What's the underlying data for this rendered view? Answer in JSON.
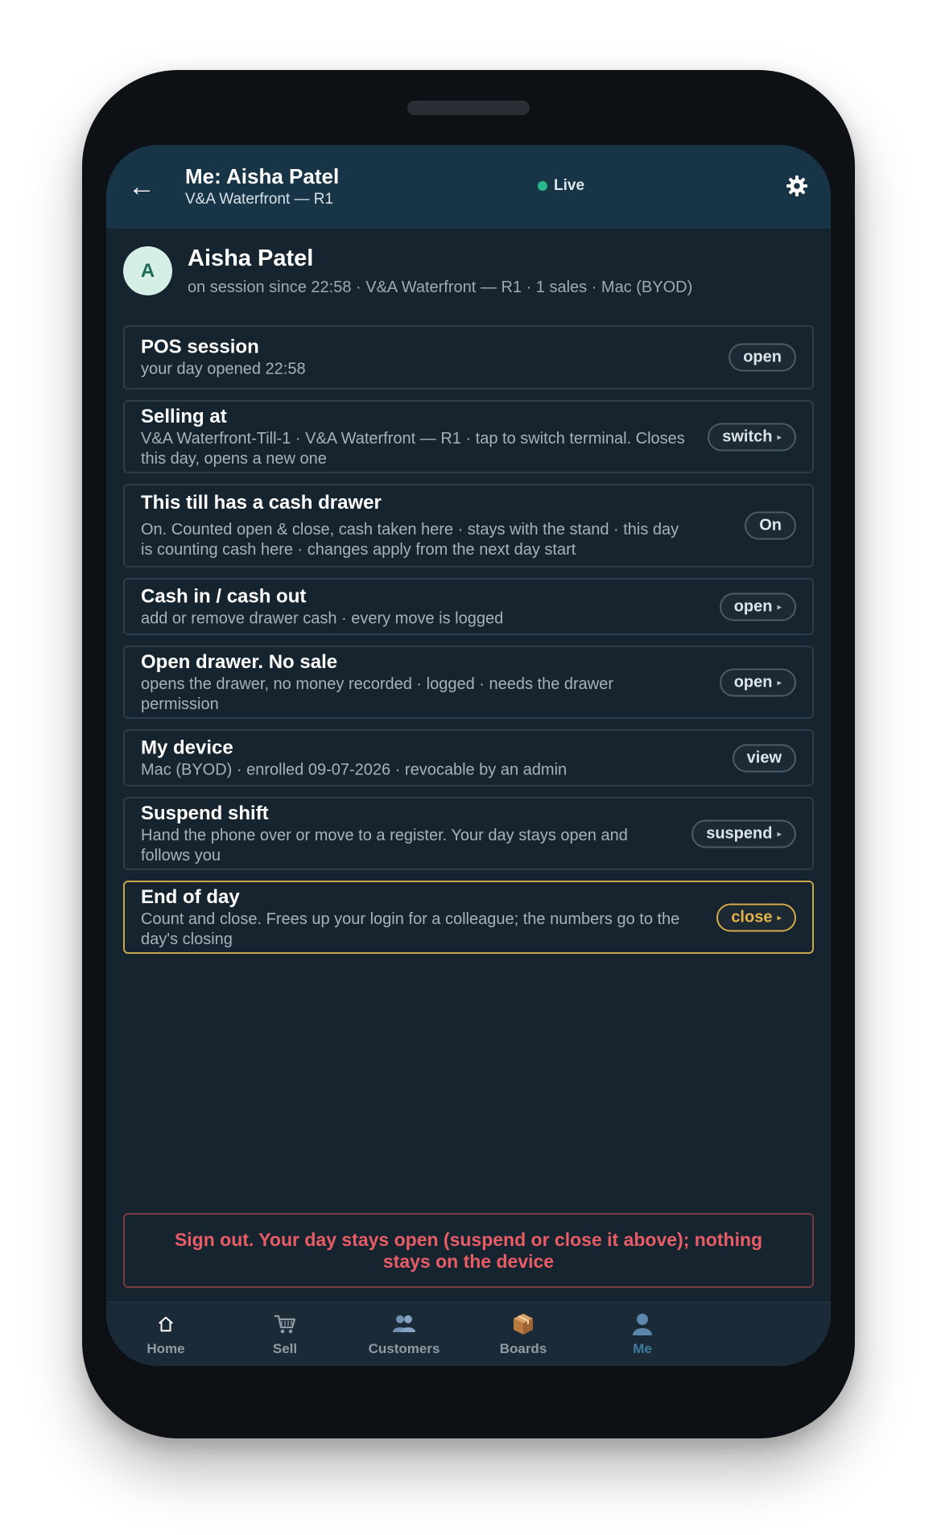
{
  "header": {
    "title": "Me: Aisha Patel",
    "subtitle": "V&A Waterfront — R1",
    "status": "Live",
    "status_color": "#28b88a"
  },
  "profile": {
    "initial": "A",
    "name": "Aisha Patel",
    "details": "on session since 22:58 · V&A Waterfront — R1 · 1 sales · Mac (BYOD)"
  },
  "cards": [
    {
      "title": "POS session",
      "sub": "your day opened 22:58",
      "action": "open"
    },
    {
      "title": "Selling at",
      "sub": "V&A Waterfront-Till-1 · V&A Waterfront — R1 · tap to switch terminal. Closes this day, opens a new one",
      "action": "switch"
    },
    {
      "title": "This till has a cash drawer",
      "sub": "On. Counted open & close, cash taken here · stays with the stand · this day is counting cash here · changes apply from the next day start",
      "action": "On"
    },
    {
      "title": "Cash in / cash out",
      "sub": "add or remove drawer cash · every move is logged",
      "action": "open"
    },
    {
      "title": "Open drawer. No sale",
      "sub": "opens the drawer, no money recorded · logged · needs the drawer permission",
      "action": "open"
    },
    {
      "title": "My device",
      "sub": "Mac (BYOD) · enrolled 09-07-2026 · revocable by an admin",
      "action": "view"
    },
    {
      "title": "Suspend shift",
      "sub": "Hand the phone over or move to a register. Your day stays open and follows you",
      "action": "suspend"
    },
    {
      "title": "End of day",
      "sub": "Count and close. Frees up your login for a colleague; the numbers go to the day's closing",
      "action": "close"
    }
  ],
  "signout": "Sign out. Your day stays open (suspend or close it above); nothing stays on the device",
  "nav": {
    "home": "Home",
    "sell": "Sell",
    "customers": "Customers",
    "boards": "Boards",
    "me": "Me",
    "active": "Me"
  },
  "colors": {
    "accent_gold": "#d6aa45",
    "danger": "#e85c66",
    "nav_active": "#3f7a9e"
  }
}
